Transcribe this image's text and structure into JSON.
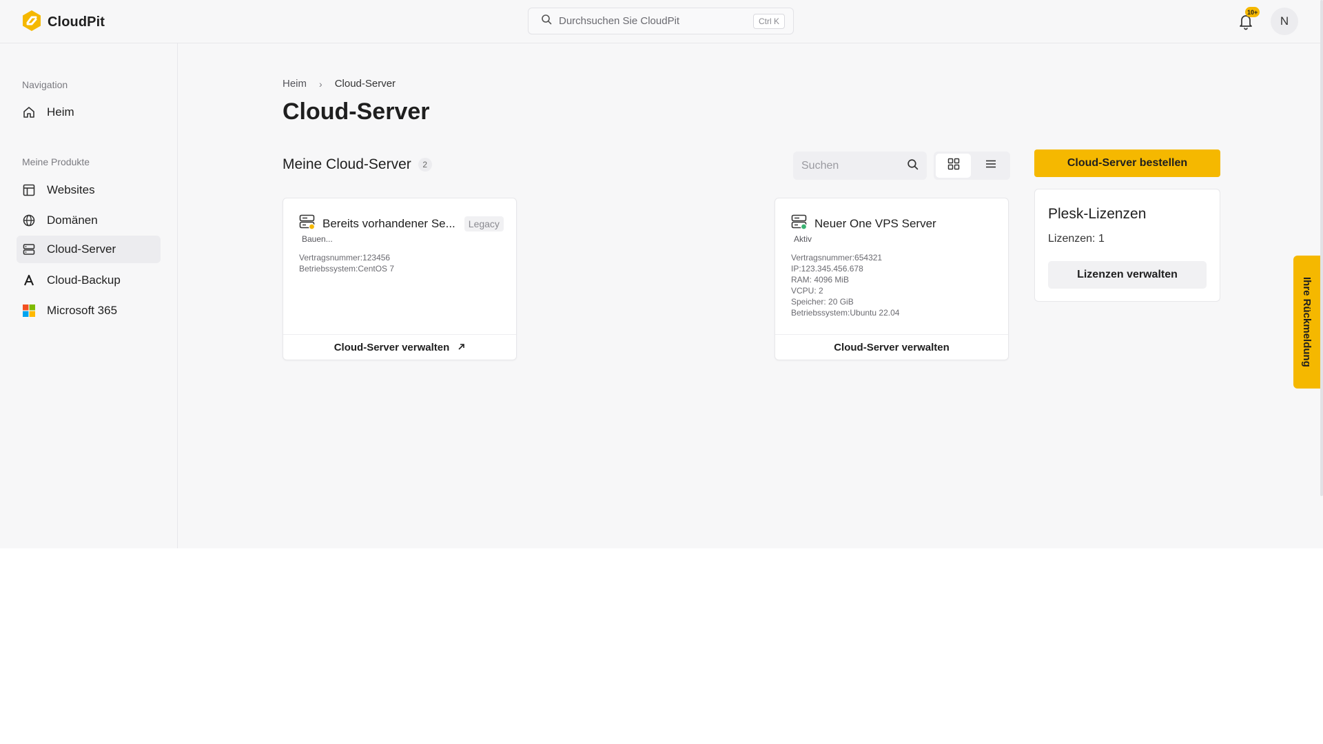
{
  "brand": {
    "name": "CloudPit",
    "accent": "#f5b800"
  },
  "header": {
    "search_placeholder": "Durchsuchen Sie CloudPit",
    "search_shortcut": "Ctrl K",
    "notification_count": "10+",
    "avatar_initial": "N"
  },
  "sidebar": {
    "section_navigation": "Navigation",
    "home_label": "Heim",
    "section_products": "Meine Produkte",
    "items": [
      {
        "label": "Websites",
        "icon": "layout-icon"
      },
      {
        "label": "Domänen",
        "icon": "globe-icon"
      },
      {
        "label": "Cloud-Server",
        "icon": "server-icon",
        "active": true
      },
      {
        "label": "Cloud-Backup",
        "icon": "backup-icon"
      },
      {
        "label": "Microsoft 365",
        "icon": "microsoft-icon"
      }
    ]
  },
  "breadcrumb": {
    "home": "Heim",
    "current": "Cloud-Server"
  },
  "page": {
    "title": "Cloud-Server",
    "section_title": "Meine Cloud-Server",
    "server_count": "2",
    "search_placeholder": "Suchen",
    "order_button": "Cloud-Server bestellen"
  },
  "servers": [
    {
      "name": "Bereits vorhandener Se...",
      "badge": "Legacy",
      "status": "Bauen...",
      "status_color": "#f5b800",
      "props": [
        {
          "label": "Vertragsnummer:",
          "value": "123456"
        },
        {
          "label": "Betriebssystem:",
          "value": "CentOS 7"
        }
      ],
      "action": "Cloud-Server verwalten"
    },
    {
      "name": "Neuer One VPS Server",
      "status": "Aktiv",
      "status_color": "#3bb273",
      "props": [
        {
          "label": "Vertragsnummer:",
          "value": "654321"
        },
        {
          "label": "IP:",
          "value": "123.345.456.678"
        },
        {
          "label": "RAM: ",
          "value": "4096 MiB"
        },
        {
          "label": "VCPU: ",
          "value": "2"
        },
        {
          "label": "Speicher: ",
          "value": "20 GiB"
        },
        {
          "label": "Betriebssystem:",
          "value": "Ubuntu 22.04"
        }
      ],
      "action": "Cloud-Server verwalten"
    }
  ],
  "plesk": {
    "title": "Plesk-Lizenzen",
    "count_label": "Lizenzen: 1",
    "button": "Lizenzen verwalten"
  },
  "feedback": {
    "label": "Ihre Rückmeldung"
  }
}
